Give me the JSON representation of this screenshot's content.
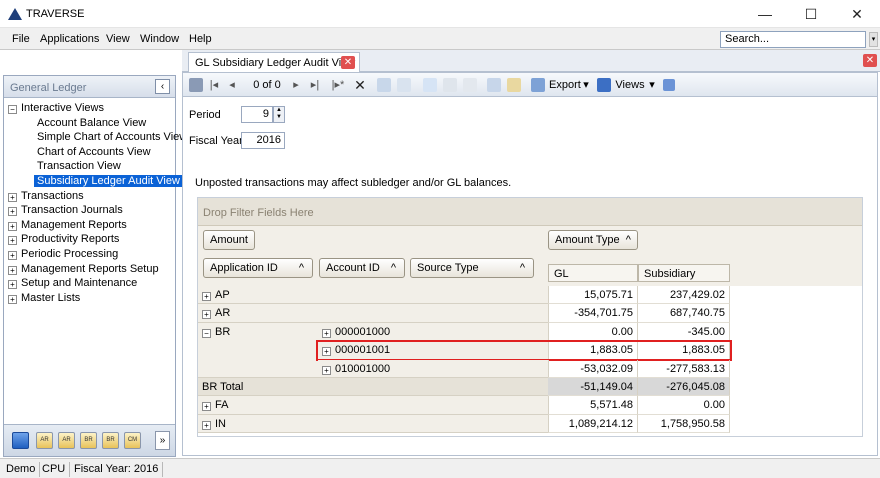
{
  "window": {
    "title": "TRAVERSE",
    "minimize": "—",
    "maximize": "☐",
    "close": "✕"
  },
  "menu": {
    "items": [
      "File",
      "Applications",
      "View",
      "Window",
      "Help"
    ],
    "search_value": "Search...",
    "scroll_glyph": "▾"
  },
  "left_panel": {
    "title": "General Ledger",
    "collapse_glyph": "‹",
    "tree": [
      {
        "label": "Interactive Views",
        "level": 0,
        "expander": "−"
      },
      {
        "label": "Account Balance View",
        "level": 1
      },
      {
        "label": "Simple Chart of Accounts View",
        "level": 1
      },
      {
        "label": "Chart of Accounts View",
        "level": 1
      },
      {
        "label": "Transaction View",
        "level": 1
      },
      {
        "label": "Subsidiary Ledger Audit View",
        "level": 1,
        "selected": true
      },
      {
        "label": "Transactions",
        "level": 0,
        "expander": "+"
      },
      {
        "label": "Transaction Journals",
        "level": 0,
        "expander": "+"
      },
      {
        "label": "Management Reports",
        "level": 0,
        "expander": "+"
      },
      {
        "label": "Productivity Reports",
        "level": 0,
        "expander": "+"
      },
      {
        "label": "Periodic Processing",
        "level": 0,
        "expander": "+"
      },
      {
        "label": "Management Reports Setup",
        "level": 0,
        "expander": "+"
      },
      {
        "label": "Setup and Maintenance",
        "level": 0,
        "expander": "+"
      },
      {
        "label": "Master Lists",
        "level": 0,
        "expander": "+"
      }
    ],
    "bottom_buttons": [
      "AR",
      "AR",
      "BR",
      "BR",
      "CM"
    ],
    "scroll_glyph": "»"
  },
  "tab": {
    "label": "GL Subsidiary Ledger Audit View",
    "close_glyph": "✕"
  },
  "toolbar": {
    "record_counter": "0 of 0",
    "export_label": "Export",
    "views_label": "Views",
    "dropdown_glyph": "▾"
  },
  "form": {
    "period_label": "Period",
    "period_value": "9",
    "fiscal_year_label": "Fiscal Year",
    "fiscal_year_value": "2016"
  },
  "notice": "Unposted transactions may affect subledger and/or GL balances.",
  "pivot": {
    "filter_placeholder": "Drop Filter Fields Here",
    "data_field": "Amount",
    "column_field": "Amount Type",
    "row_fields": [
      "Application ID",
      "Account ID",
      "Source Type"
    ],
    "sort_glyph": "^",
    "columns": [
      "GL",
      "Subsidiary"
    ],
    "rows": [
      {
        "app": "AP",
        "expander": "+",
        "account": "",
        "gl": "15,075.71",
        "sub": "237,429.02"
      },
      {
        "app": "AR",
        "expander": "+",
        "account": "",
        "gl": "-354,701.75",
        "sub": "687,740.75"
      },
      {
        "app": "BR",
        "expander": "−",
        "account": "000001000",
        "acc_expander": "+",
        "gl": "0.00",
        "sub": "-345.00"
      },
      {
        "app": "",
        "account": "000001001",
        "acc_expander": "+",
        "gl": "1,883.05",
        "sub": "1,883.05",
        "highlighted": true
      },
      {
        "app": "",
        "account": "010001000",
        "acc_expander": "+",
        "gl": "-53,032.09",
        "sub": "-277,583.13"
      },
      {
        "app": "BR Total",
        "account": "",
        "gl": "-51,149.04",
        "sub": "-276,045.08",
        "total": true
      },
      {
        "app": "FA",
        "expander": "+",
        "account": "",
        "gl": "5,571.48",
        "sub": "0.00"
      },
      {
        "app": "IN",
        "expander": "+",
        "account": "",
        "gl": "1,089,214.12",
        "sub": "1,758,950.58"
      }
    ]
  },
  "status": {
    "items": [
      "Demo",
      "CPU",
      "Fiscal Year: 2016"
    ]
  },
  "colors": {
    "accent": "#0b62d6",
    "highlight": "#e02020",
    "close_red": "#e05050"
  }
}
